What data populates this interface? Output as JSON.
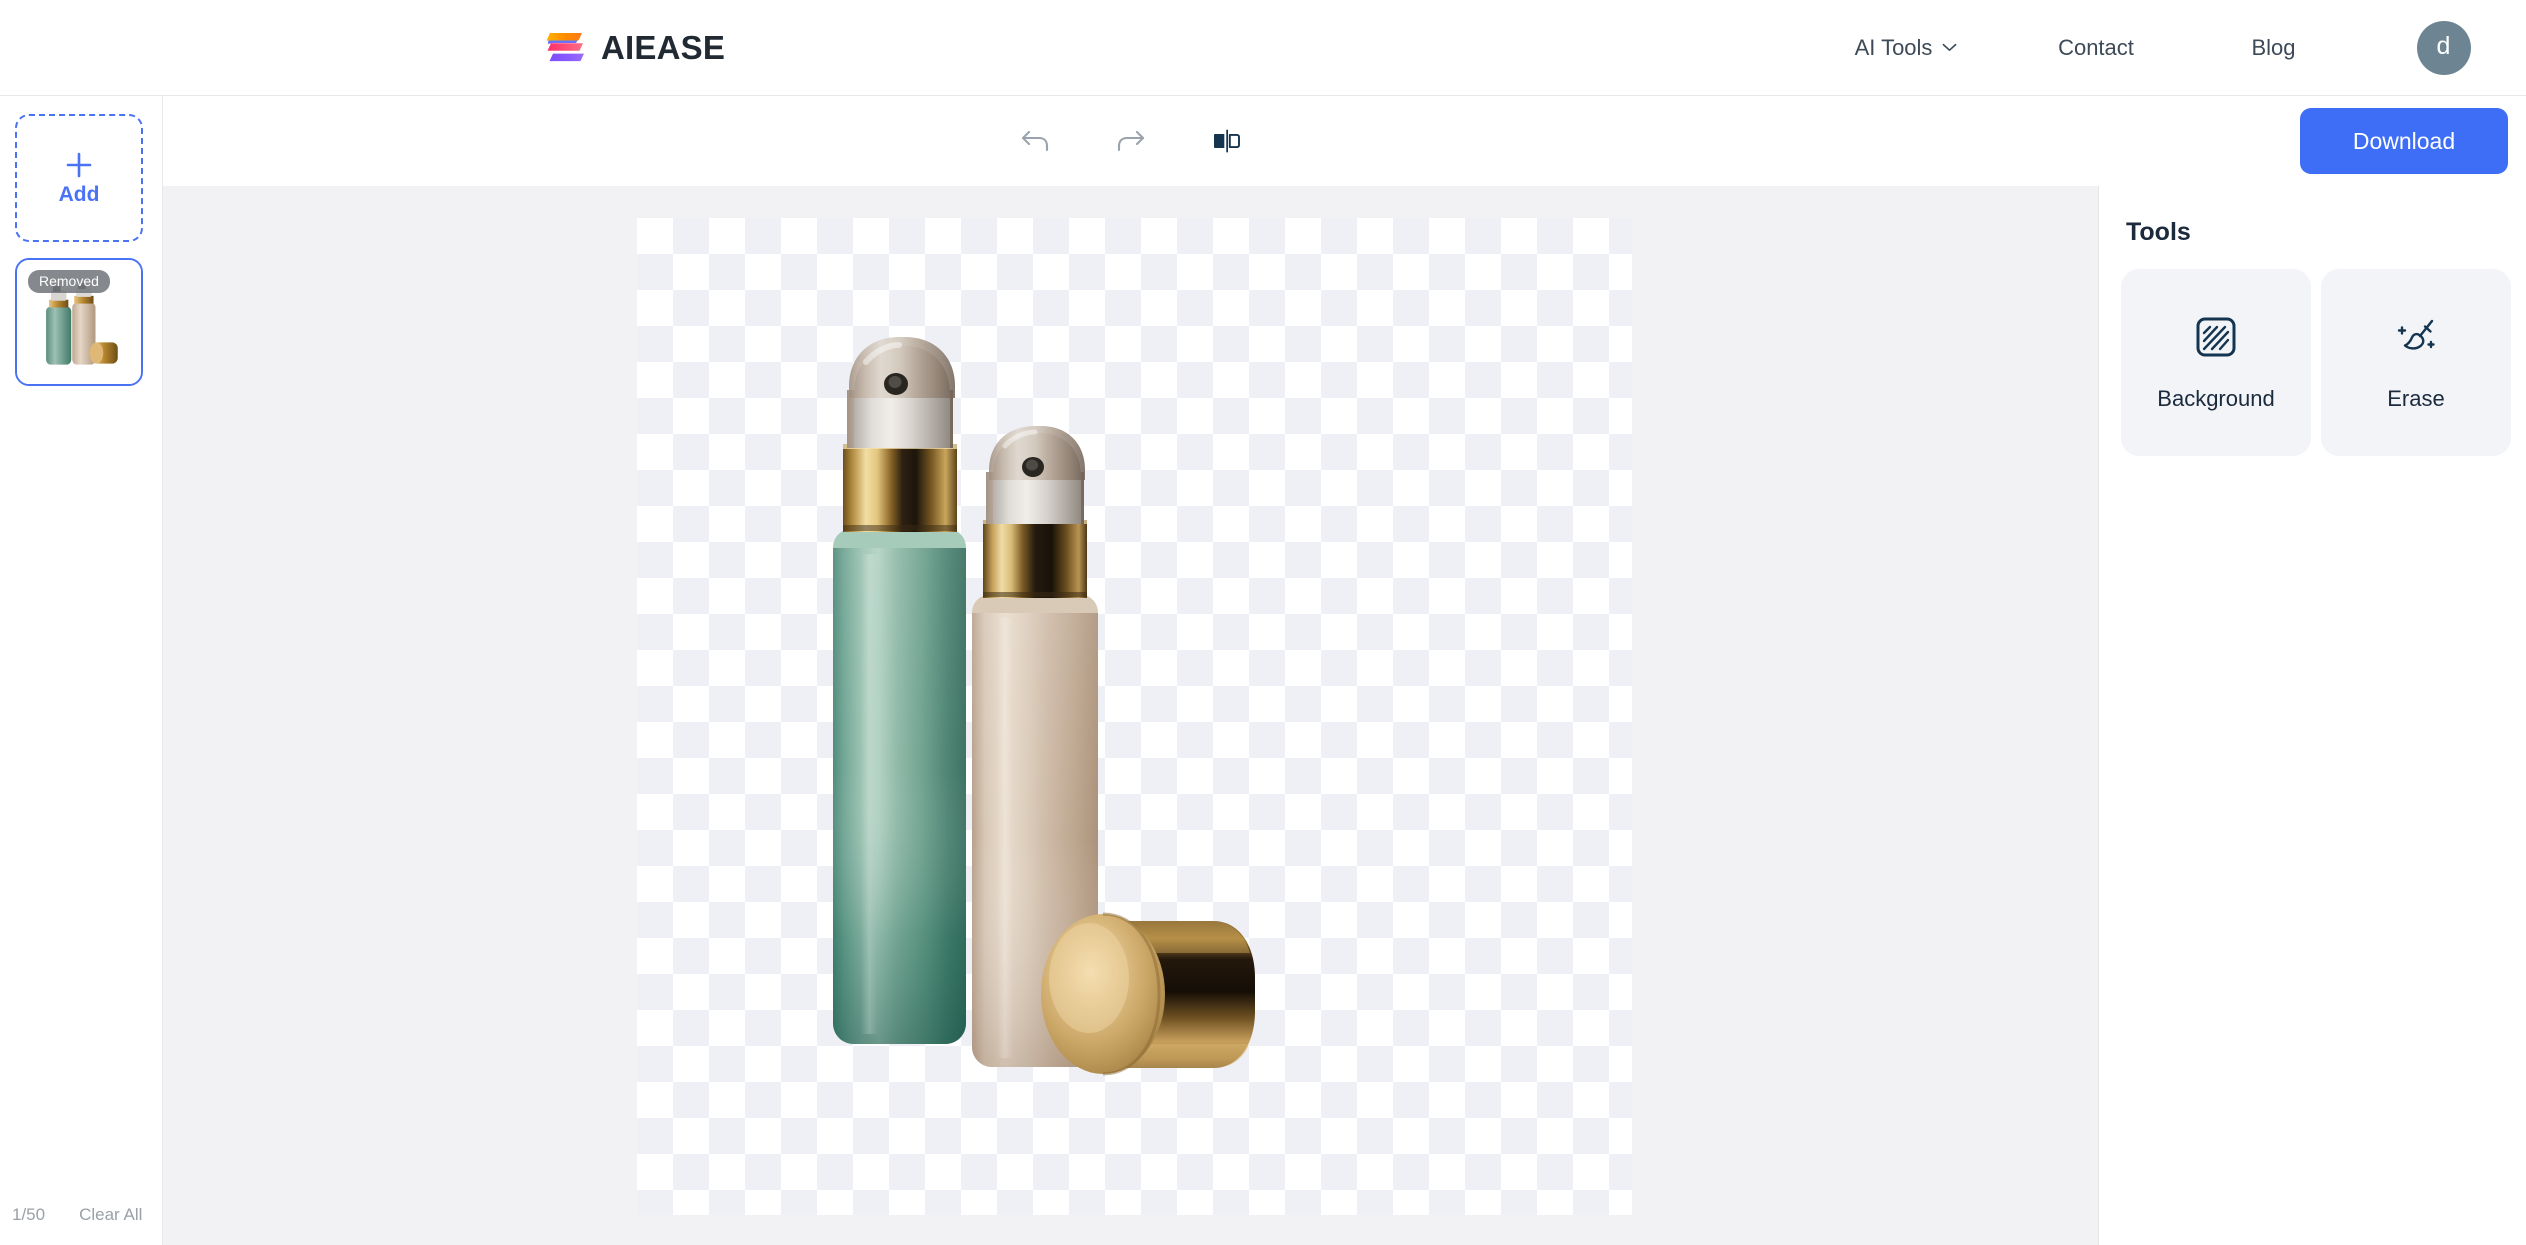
{
  "header": {
    "brand_name": "AIEASE",
    "logo_icon": "aiease-logo-icon",
    "nav": [
      {
        "label": "AI Tools",
        "icon": "chevron-down-icon",
        "has_dropdown": true
      },
      {
        "label": "Contact",
        "has_dropdown": false
      },
      {
        "label": "Blog",
        "has_dropdown": false
      }
    ],
    "avatar_initial": "d",
    "avatar_color": "#6d8593"
  },
  "sidebar": {
    "add_label": "Add",
    "add_icon": "plus-icon",
    "thumbnails": [
      {
        "badge": "Removed",
        "selected": true,
        "alt": "cosmetic-bottles-background-removed"
      }
    ],
    "count_label": "1/50",
    "clear_all_label": "Clear All"
  },
  "toolbar": {
    "buttons": [
      {
        "name": "undo",
        "icon": "undo-arrow-icon",
        "state": "disabled",
        "color": "#9aa3ad"
      },
      {
        "name": "redo",
        "icon": "redo-arrow-icon",
        "state": "disabled",
        "color": "#9aa3ad"
      },
      {
        "name": "compare",
        "icon": "compare-split-icon",
        "state": "active",
        "color": "#14344f"
      }
    ]
  },
  "canvas": {
    "transparency_pattern": "checkerboard",
    "checker_light": "#ffffff",
    "checker_dark": "#eef0f5",
    "image_description": "Two cosmetic pump bottles, one teal-green and one beige, with a gold cap lying on its side",
    "stage_background": "#f2f2f4"
  },
  "right_panel": {
    "download_label": "Download",
    "download_color": "#3d6ef5",
    "tools_title": "Tools",
    "tools": [
      {
        "label": "Background",
        "icon": "background-hatch-icon"
      },
      {
        "label": "Erase",
        "icon": "magic-brush-erase-icon"
      }
    ]
  }
}
